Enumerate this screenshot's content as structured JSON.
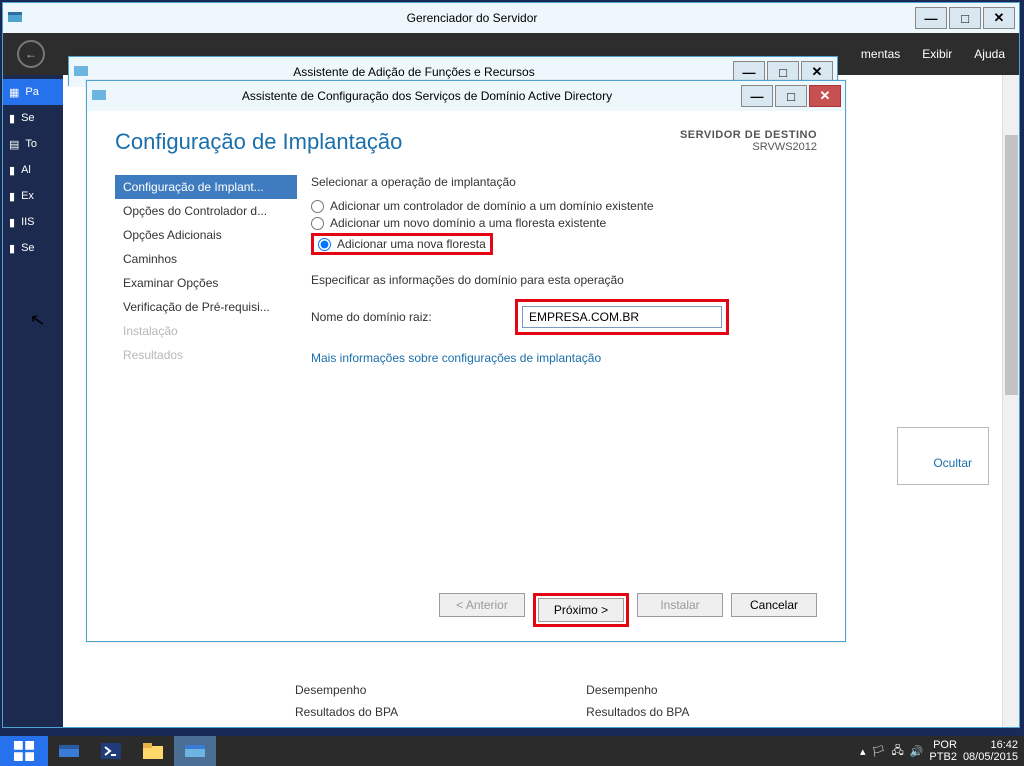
{
  "server_manager": {
    "title": "Gerenciador do Servidor",
    "menus": {
      "m1": "mentas",
      "m2": "Exibir",
      "m3": "Ajuda"
    },
    "nav": [
      "Pa",
      "Se",
      "To",
      "Al",
      "Ex",
      "IIS",
      "Se"
    ],
    "ocultar": "Ocultar",
    "cards": {
      "desempenho": "Desempenho",
      "bpa": "Resultados do BPA"
    }
  },
  "wizard_mid": {
    "title": "Assistente de Adição de Funções e Recursos"
  },
  "wizard": {
    "title": "Assistente de Configuração dos Serviços de Domínio Active Directory",
    "heading": "Configuração de Implantação",
    "dest_label": "SERVIDOR DE DESTINO",
    "dest_value": "SRVWS2012",
    "steps": [
      "Configuração de Implant...",
      "Opções do Controlador d...",
      "Opções Adicionais",
      "Caminhos",
      "Examinar Opções",
      "Verificação de Pré-requisi...",
      "Instalação",
      "Resultados"
    ],
    "form": {
      "group_title": "Selecionar a operação de implantação",
      "radio1": "Adicionar um controlador de domínio a um domínio existente",
      "radio2": "Adicionar um novo domínio a uma floresta existente",
      "radio3": "Adicionar uma nova floresta",
      "spec_title": "Especificar as informações do domínio para esta operação",
      "domain_label": "Nome do domínio raiz:",
      "domain_value": "EMPRESA.COM.BR",
      "more_link": "Mais informações sobre configurações de implantação"
    },
    "buttons": {
      "prev": "< Anterior",
      "next": "Próximo >",
      "install": "Instalar",
      "cancel": "Cancelar"
    }
  },
  "taskbar": {
    "lang": "POR",
    "kbd": "PTB2",
    "time": "16:42",
    "date": "08/05/2015"
  }
}
